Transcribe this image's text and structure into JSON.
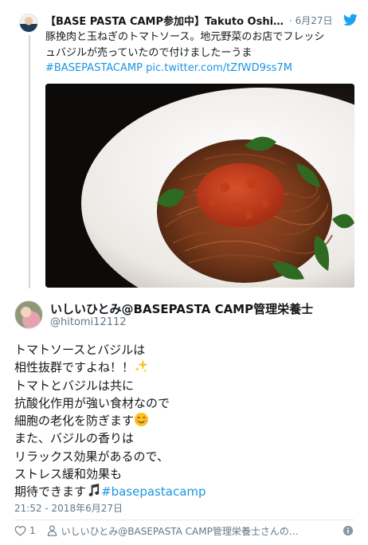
{
  "parent_tweet": {
    "author_name": "【BASE PASTA CAMP参加中】Takuto Oshi...",
    "date": "· 6月27日",
    "text_line1": "豚挽肉と玉ねぎのトマトソース。地元野菜のお店でフレッシ",
    "text_line2": "ュバジルが売っていたので付けましたーうま",
    "hashtag": "#BASEPASTACAMP",
    "link": "pic.twitter.com/tZfWD9ss7M",
    "photo_icon": "pasta-photo",
    "avatar_icon": "author-avatar"
  },
  "reply_tweet": {
    "author_name": "いしいひとみ@BASEPASTA CAMP管理栄養士",
    "handle": "@hitomi12112",
    "lines": [
      "トマトソースとバジルは",
      "相性抜群ですよね！！",
      "トマトとバジルは共に",
      "抗酸化作用が強い食材なので",
      "細胞の老化を防ぎます",
      "また、バジルの香りは",
      "リラックス効果があるので、",
      "ストレス緩和効果も",
      "期待できます"
    ],
    "hashtag": "#basepastacamp",
    "timestamp": "21:52 - 2018年6月27日",
    "avatar_icon": "reply-avatar"
  },
  "actions": {
    "like_count": "1",
    "profile_text": "いしいひとみ@BASEPASTA CAMP管理栄養士さんの…"
  },
  "colors": {
    "link": "#1b95e0",
    "text": "#14171a",
    "muted": "#657786",
    "twitter_blue": "#1da1f2"
  }
}
